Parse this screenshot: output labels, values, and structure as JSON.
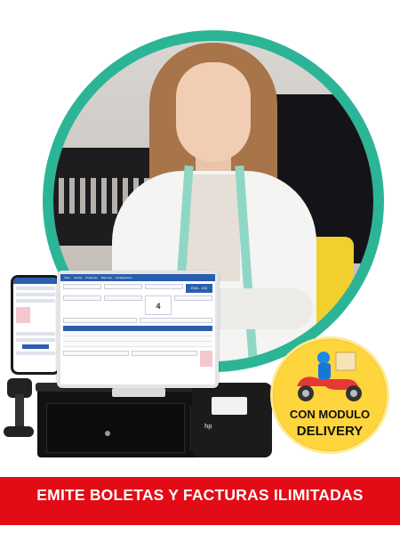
{
  "tablet": {
    "menu": [
      "Inicio",
      "Ventas",
      "Productos",
      "Reportes",
      "Configuracion"
    ],
    "total": "4",
    "badge": "EVA - 153"
  },
  "badge": {
    "line1": "CON MODULO",
    "line2": "DELIVERY",
    "icon": "delivery-scooter-icon"
  },
  "banner": {
    "text": "EMITE BOLETAS Y FACTURAS ILIMITADAS"
  },
  "colors": {
    "ring": "#2bb596",
    "banner": "#e30b16",
    "badge": "#ffd53d",
    "ui_blue": "#2a5fad"
  }
}
